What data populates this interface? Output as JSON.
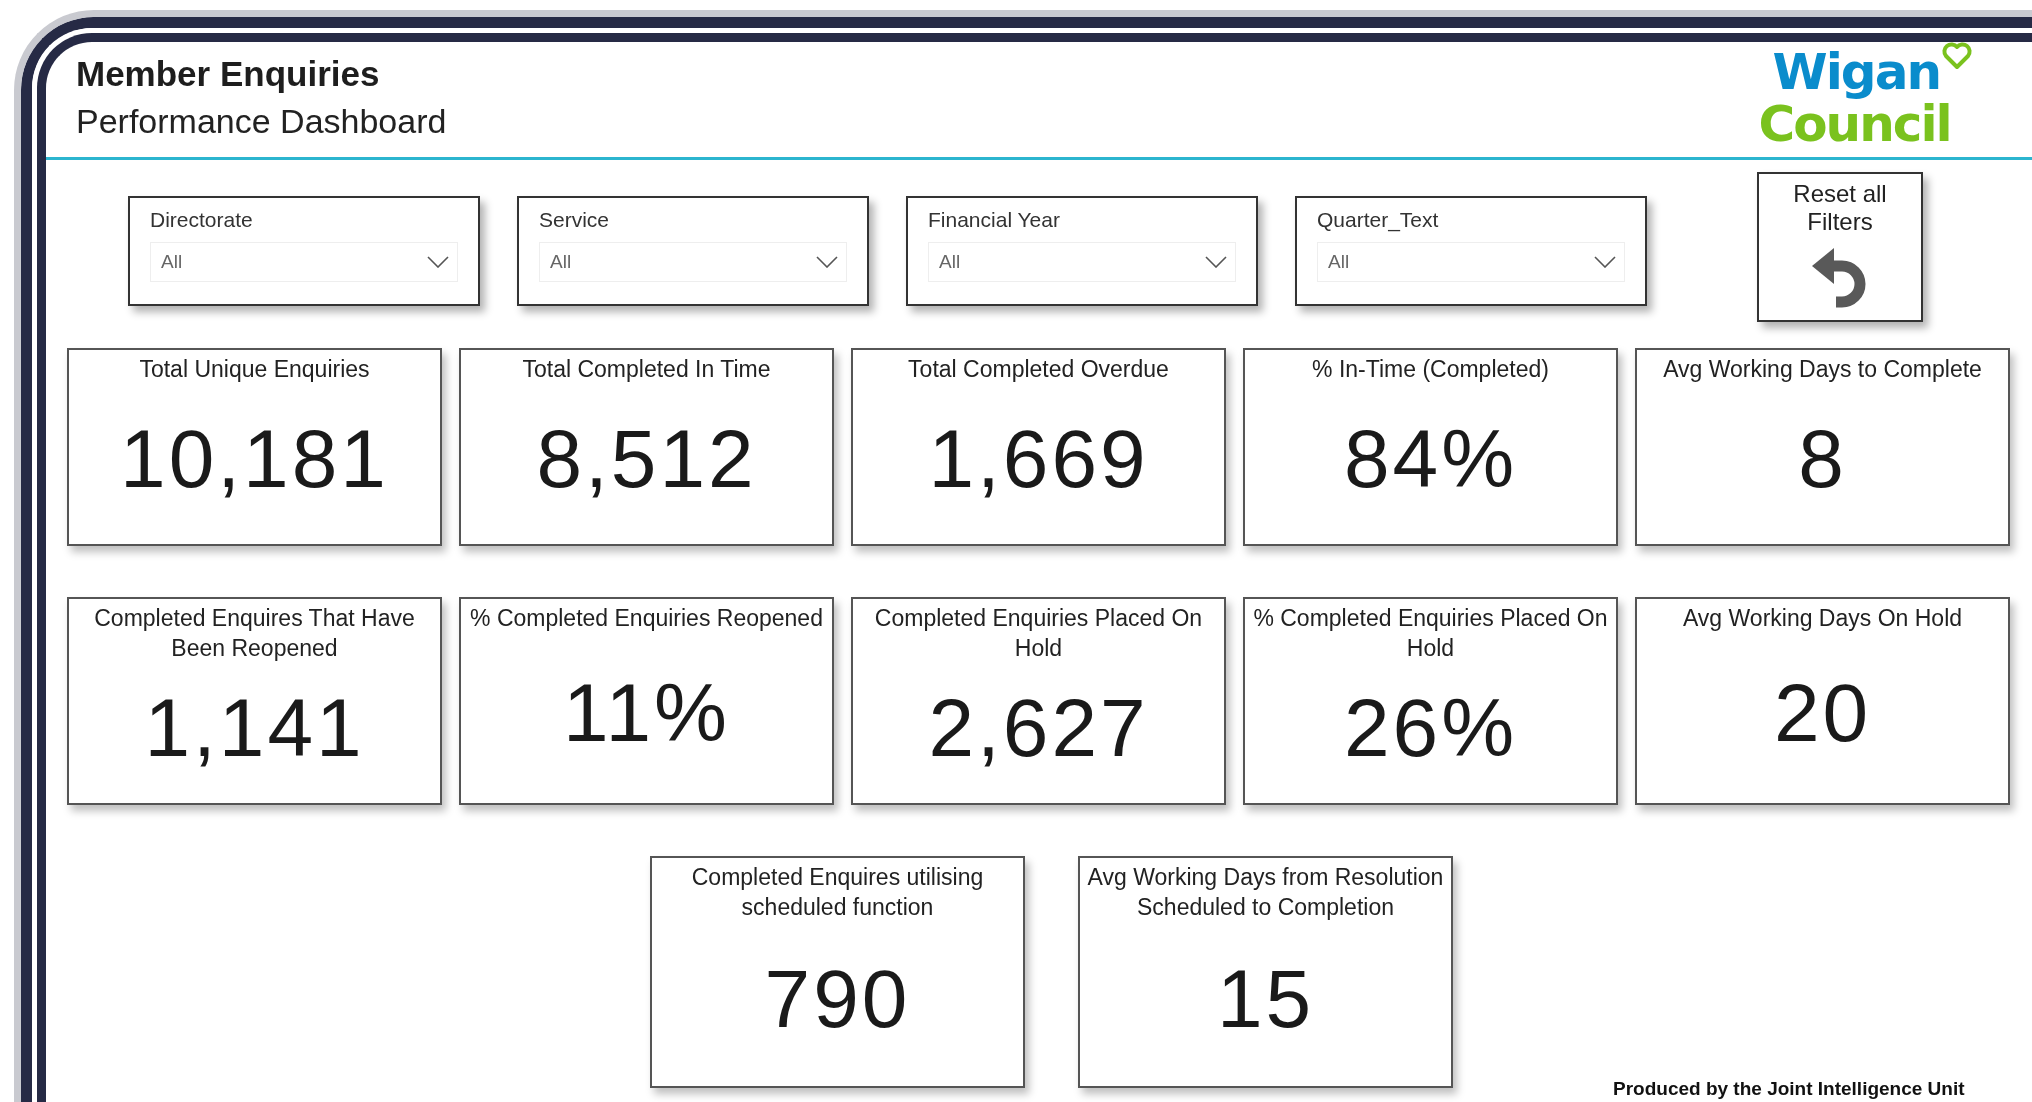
{
  "header": {
    "title": "Member Enquiries",
    "subtitle": "Performance Dashboard",
    "logo_top": "Wigan",
    "logo_bottom": "Council"
  },
  "slicers": [
    {
      "label": "Directorate",
      "value": "All"
    },
    {
      "label": "Service",
      "value": "All"
    },
    {
      "label": "Financial Year",
      "value": "All"
    },
    {
      "label": "Quarter_Text",
      "value": "All"
    }
  ],
  "reset_button": "Reset all Filters",
  "kpi_rows": [
    [
      {
        "title": "Total Unique Enquiries",
        "value": "10,181"
      },
      {
        "title": "Total Completed In Time",
        "value": "8,512"
      },
      {
        "title": "Total Completed Overdue",
        "value": "1,669"
      },
      {
        "title": "% In-Time (Completed)",
        "value": "84%"
      },
      {
        "title": "Avg Working Days to Complete",
        "value": "8"
      }
    ],
    [
      {
        "title": "Completed Enquires That Have Been Reopened",
        "value": "1,141"
      },
      {
        "title": "% Completed Enquiries Reopened",
        "value": "11%"
      },
      {
        "title": "Completed Enquiries Placed On Hold",
        "value": "2,627"
      },
      {
        "title": "% Completed Enquiries Placed On Hold",
        "value": "26%"
      },
      {
        "title": "Avg Working Days On Hold",
        "value": "20"
      }
    ],
    [
      {
        "title": "Completed Enquires utilising scheduled function",
        "value": "790"
      },
      {
        "title": "Avg Working Days from Resolution Scheduled to Completion",
        "value": "15"
      }
    ]
  ],
  "footer": "Produced by the Joint Intelligence Unit"
}
